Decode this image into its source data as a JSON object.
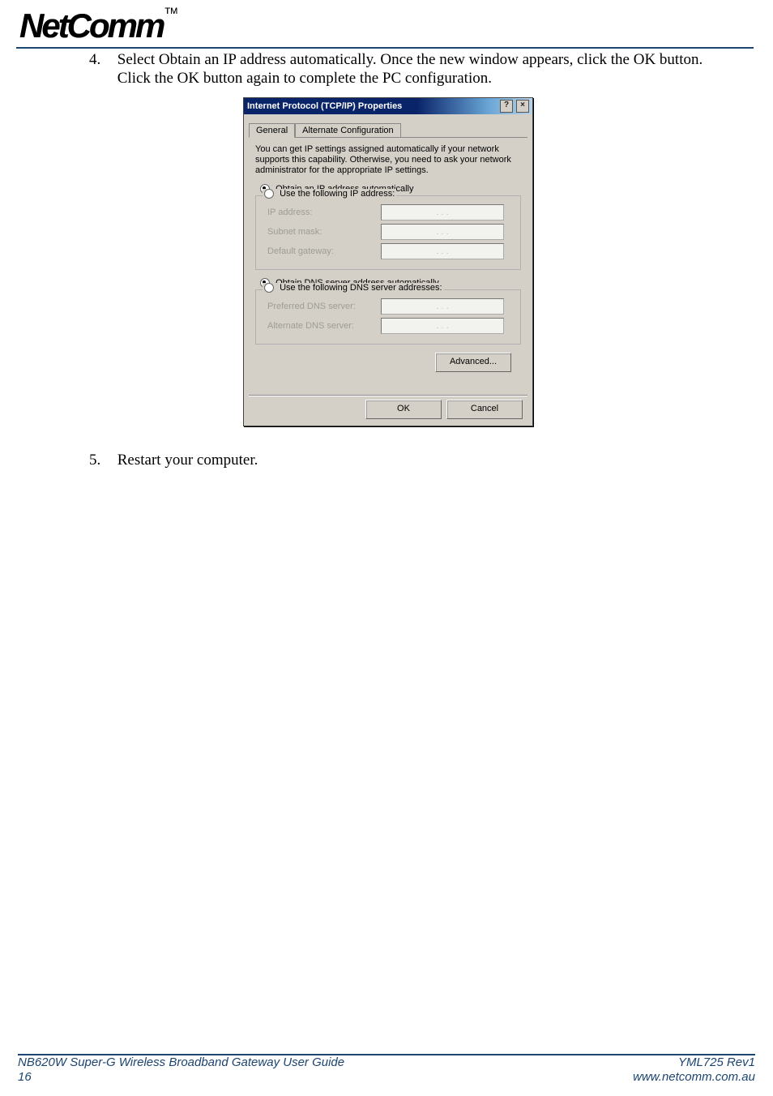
{
  "logo": {
    "text": "NetComm",
    "tm": "TM"
  },
  "instructions": {
    "step4": {
      "num": "4.",
      "text": "Select Obtain an IP address automatically. Once the new window appears, click the OK button. Click the OK button again to complete the PC configuration."
    },
    "step5": {
      "num": "5.",
      "text": "Restart your computer."
    }
  },
  "dialog": {
    "title": "Internet Protocol (TCP/IP) Properties",
    "help": "?",
    "close": "×",
    "tabs": {
      "general": "General",
      "alternate": "Alternate Configuration"
    },
    "desc": "You can get IP settings assigned automatically if your network supports this capability. Otherwise, you need to ask your network administrator for the appropriate IP settings.",
    "ip_auto": "Obtain an IP address automatically",
    "ip_manual": "Use the following IP address:",
    "ip_fields": {
      "addr": "IP address:",
      "mask": "Subnet mask:",
      "gw": "Default gateway:"
    },
    "dns_auto": "Obtain DNS server address automatically",
    "dns_manual": "Use the following DNS server addresses:",
    "dns_fields": {
      "pref": "Preferred DNS server:",
      "alt": "Alternate DNS server:"
    },
    "advanced": "Advanced...",
    "ok": "OK",
    "cancel": "Cancel",
    "dots": ". . ."
  },
  "footer": {
    "left_line1": "NB620W Super-G Wireless Broadband  Gateway User Guide",
    "left_line2": "16",
    "right_line1": "YML725 Rev1",
    "right_line2": "www.netcomm.com.au"
  }
}
